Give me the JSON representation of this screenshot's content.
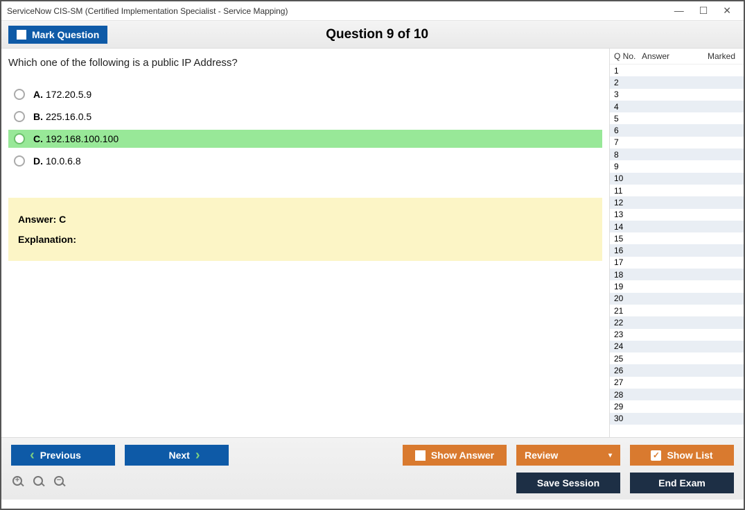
{
  "window": {
    "title": "ServiceNow CIS-SM (Certified Implementation Specialist - Service Mapping)"
  },
  "header": {
    "mark_label": "Mark Question",
    "question_title": "Question 9 of 10"
  },
  "question": {
    "text": "Which one of the following is a public IP Address?",
    "options": [
      {
        "letter": "A.",
        "text": "172.20.5.9",
        "correct": false
      },
      {
        "letter": "B.",
        "text": "225.16.0.5",
        "correct": false
      },
      {
        "letter": "C.",
        "text": "192.168.100.100",
        "correct": true
      },
      {
        "letter": "D.",
        "text": "10.0.6.8",
        "correct": false
      }
    ],
    "answer_label": "Answer: C",
    "explanation_label": "Explanation:"
  },
  "sidebar": {
    "col_qno": "Q No.",
    "col_answer": "Answer",
    "col_marked": "Marked",
    "row_count": 30
  },
  "buttons": {
    "previous": "Previous",
    "next": "Next",
    "show_answer": "Show Answer",
    "review": "Review",
    "show_list": "Show List",
    "save_session": "Save Session",
    "end_exam": "End Exam"
  }
}
